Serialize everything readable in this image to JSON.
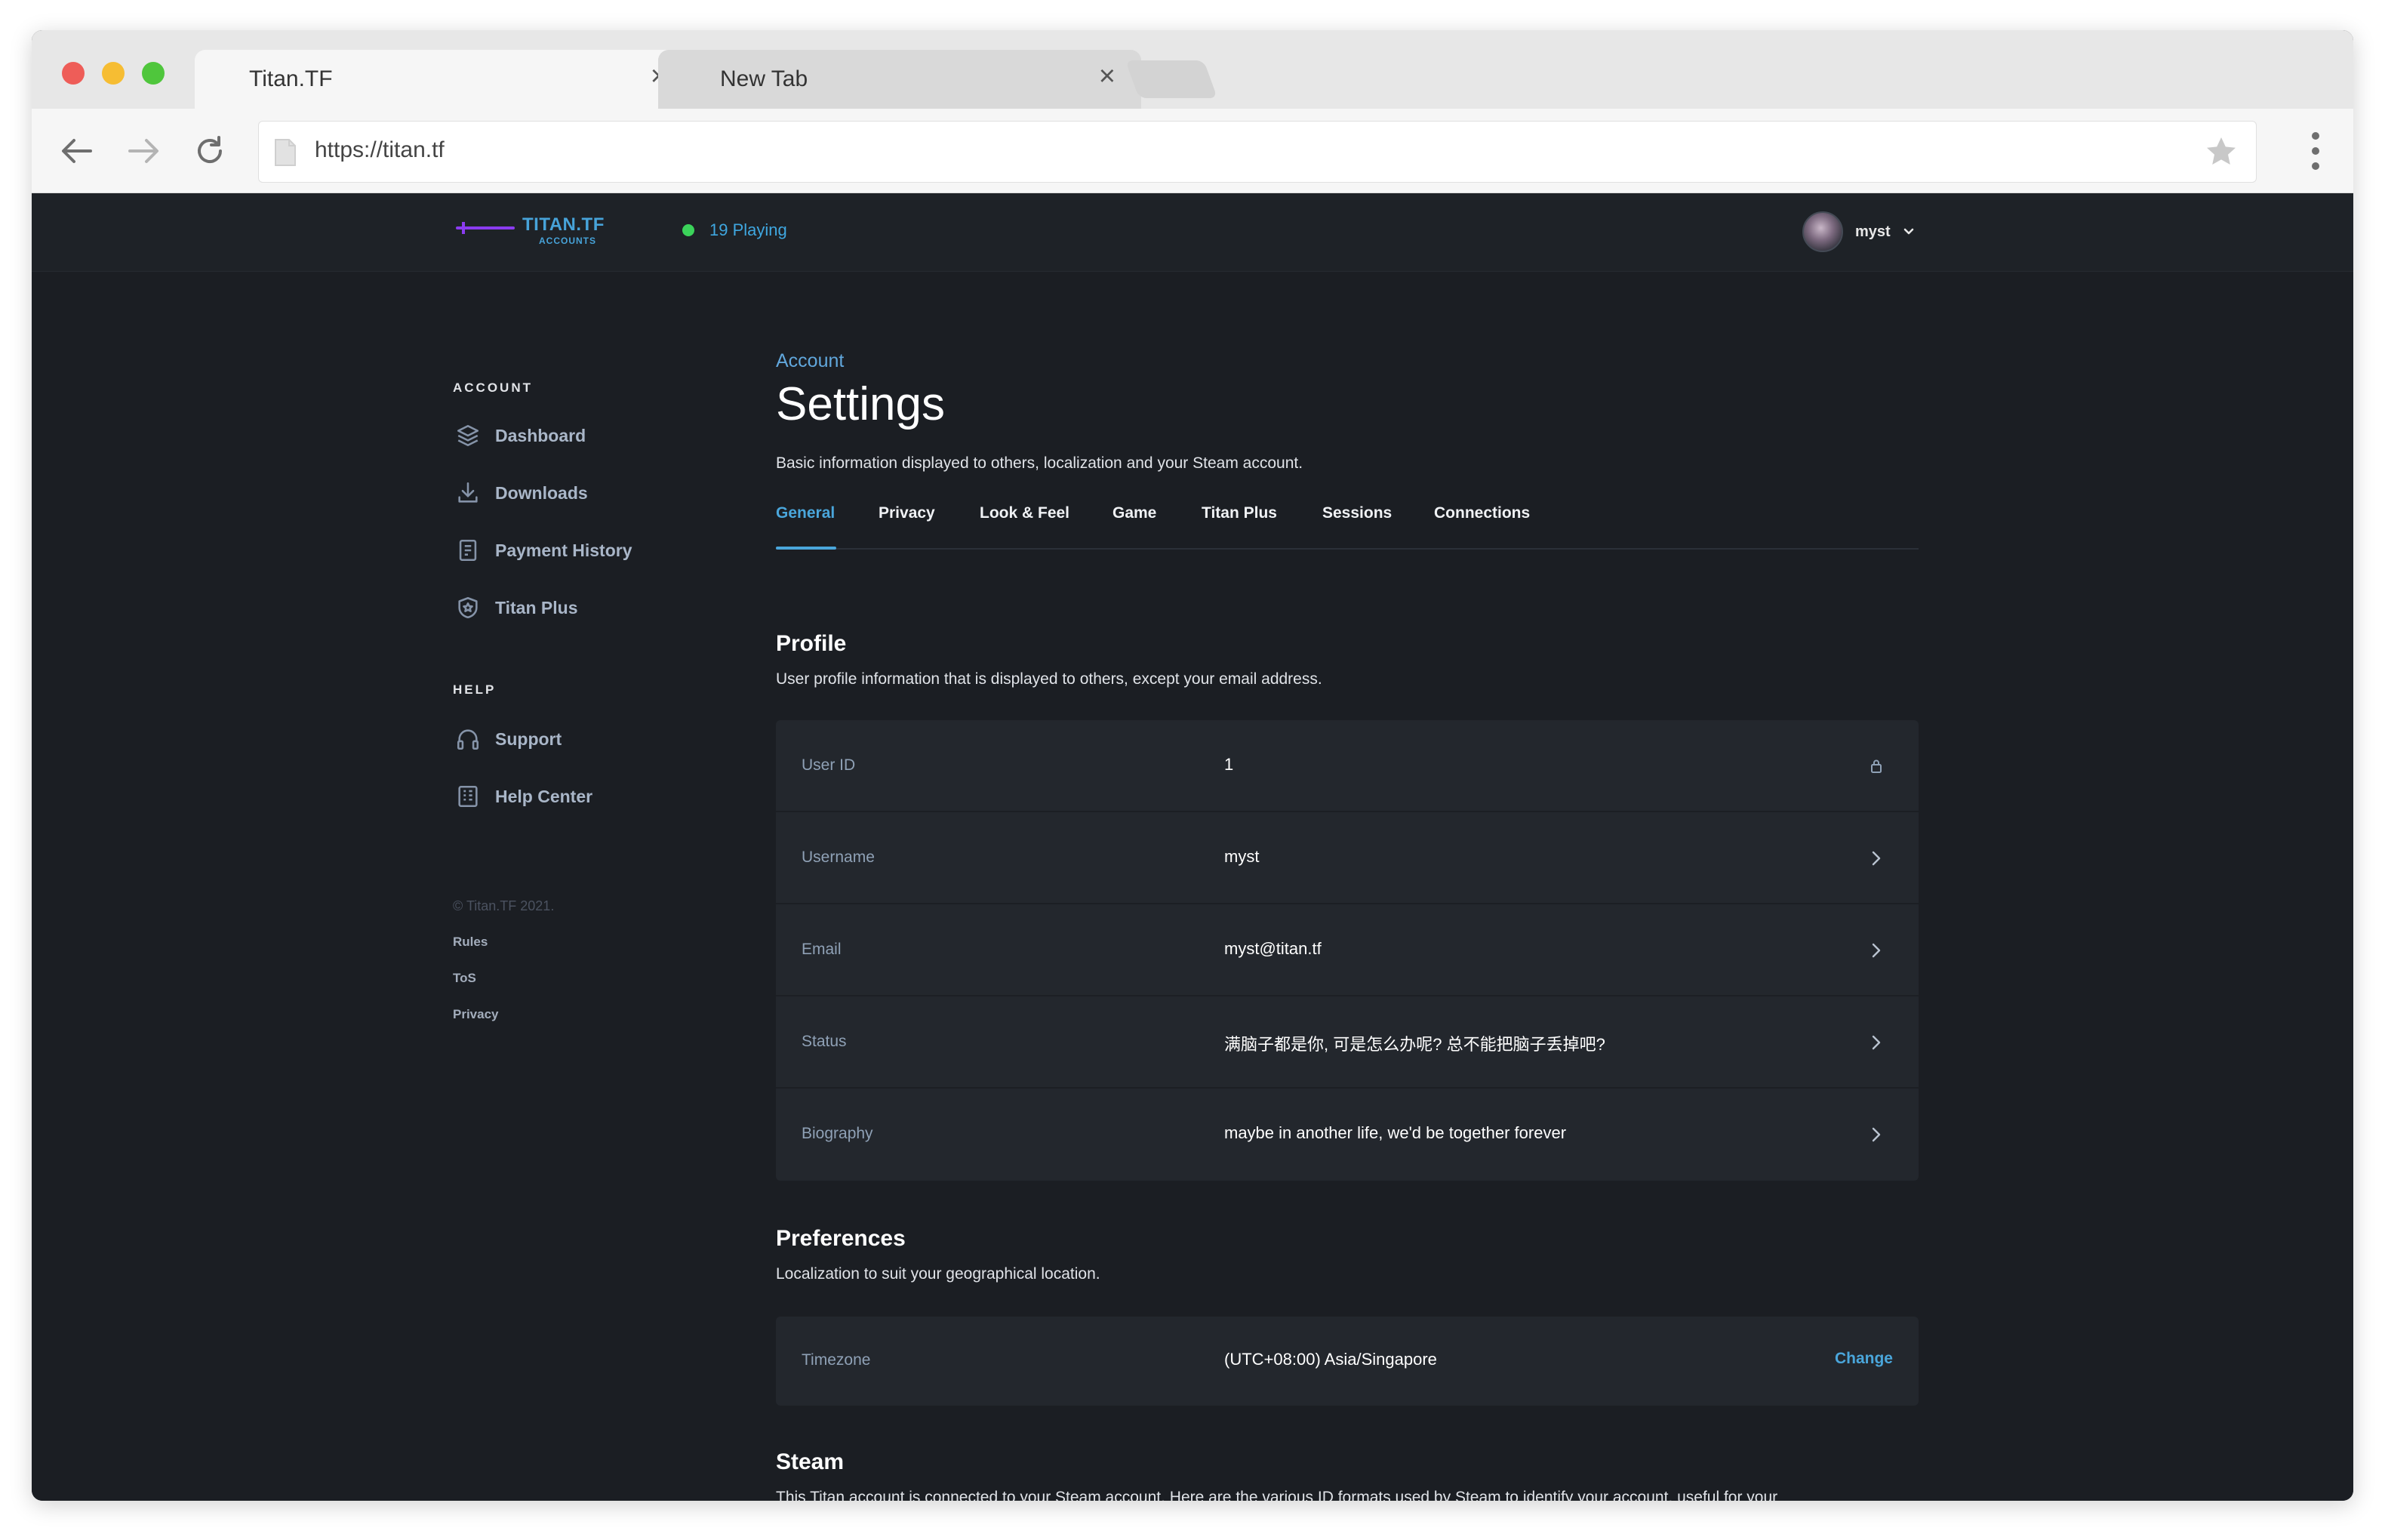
{
  "browser": {
    "tabs": [
      {
        "title": "Titan.TF",
        "active": true
      },
      {
        "title": "New Tab",
        "active": false
      }
    ],
    "url": "https://titan.tf"
  },
  "header": {
    "logo_name": "TITAN.TF",
    "logo_sub": "ACCOUNTS",
    "playing": "19 Playing",
    "username": "myst",
    "online_color": "#3bd35a"
  },
  "sidebar": {
    "account_title": "ACCOUNT",
    "account_items": [
      {
        "label": "Dashboard",
        "icon": "layers-icon"
      },
      {
        "label": "Downloads",
        "icon": "download-icon"
      },
      {
        "label": "Payment History",
        "icon": "receipt-icon"
      },
      {
        "label": "Titan Plus",
        "icon": "shield-icon"
      }
    ],
    "help_title": "HELP",
    "help_items": [
      {
        "label": "Support",
        "icon": "headphones-icon"
      },
      {
        "label": "Help Center",
        "icon": "document-icon"
      }
    ],
    "copyright": "© Titan.TF 2021.",
    "links": [
      "Rules",
      "ToS",
      "Privacy"
    ]
  },
  "main": {
    "breadcrumb": "Account",
    "title": "Settings",
    "description": "Basic information displayed to others, localization and your Steam account.",
    "tabs": [
      "General",
      "Privacy",
      "Look & Feel",
      "Game",
      "Titan Plus",
      "Sessions",
      "Connections"
    ],
    "active_tab": "General",
    "profile": {
      "title": "Profile",
      "description": "User profile information that is displayed to others, except your email address.",
      "rows": [
        {
          "label": "User ID",
          "value": "1",
          "action": "lock-icon"
        },
        {
          "label": "Username",
          "value": "myst",
          "action": "chevron-right-icon"
        },
        {
          "label": "Email",
          "value": "myst@titan.tf",
          "action": "chevron-right-icon"
        },
        {
          "label": "Status",
          "value": "满脑子都是你, 可是怎么办呢? 总不能把脑子丢掉吧?",
          "action": "chevron-right-icon"
        },
        {
          "label": "Biography",
          "value": "maybe in another life, we'd be together forever",
          "action": "chevron-right-icon"
        }
      ]
    },
    "preferences": {
      "title": "Preferences",
      "description": "Localization to suit your geographical location.",
      "timezone_label": "Timezone",
      "timezone_value": "(UTC+08:00) Asia/Singapore",
      "change_label": "Change"
    },
    "steam": {
      "title": "Steam",
      "description": "This Titan account is connected to your Steam account. Here are the various ID formats used by Steam to identify your account, useful for your"
    },
    "accent_color": "#4aa6db"
  }
}
